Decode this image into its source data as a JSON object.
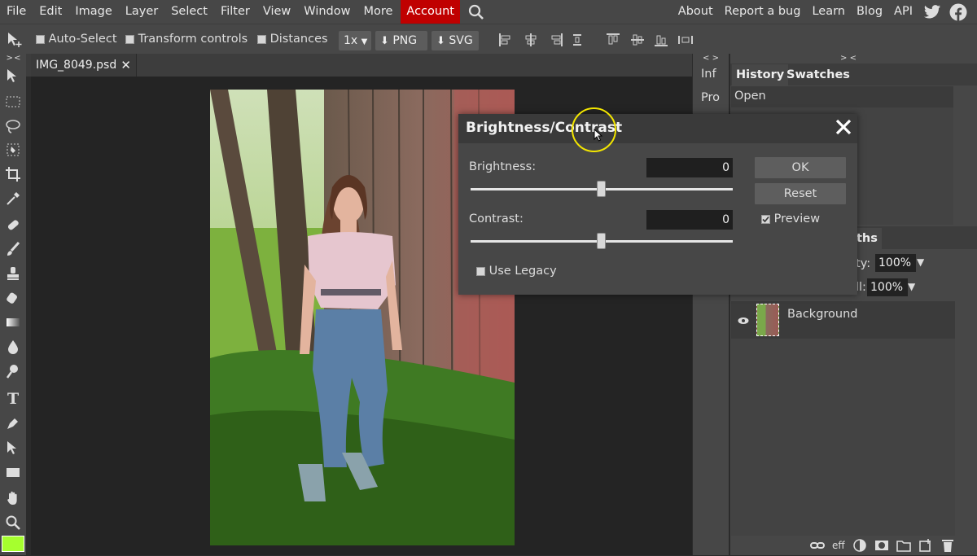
{
  "menu": {
    "left": [
      "File",
      "Edit",
      "Image",
      "Layer",
      "Select",
      "Filter",
      "View",
      "Window",
      "More",
      "Account"
    ],
    "right": [
      "About",
      "Report a bug",
      "Learn",
      "Blog",
      "API"
    ]
  },
  "options": {
    "auto_select": "Auto-Select",
    "transform_controls": "Transform controls",
    "distances": "Distances",
    "zoom": "1x",
    "png": "PNG",
    "svg": "SVG"
  },
  "collapse_glyph_left": "> <",
  "collapse_glyph_mid": "< >",
  "collapse_glyph_right": "> <",
  "document": {
    "tab_name": "IMG_8049.psd"
  },
  "mini_panels": [
    "Inf",
    "Pro"
  ],
  "history": {
    "tabs": [
      "History",
      "Swatches"
    ],
    "items": [
      "Open"
    ]
  },
  "layers": {
    "tab_fragment": "ths",
    "opacity_label": "ity:",
    "opacity_value": "100%",
    "fill_label": "ll:",
    "fill_value": "100%",
    "layer_name": "Background",
    "footer_eff": "eff"
  },
  "dialog": {
    "title": "Brightness/Contrast",
    "brightness_label": "Brightness:",
    "brightness_value": "0",
    "contrast_label": "Contrast:",
    "contrast_value": "0",
    "brightness_level": 0.5,
    "contrast_level": 0.5,
    "use_legacy": "Use Legacy",
    "preview": "Preview",
    "ok": "OK",
    "reset": "Reset"
  },
  "colors": {
    "foreground": "#a6ff2e",
    "account_bg": "#c00000",
    "highlight_ring": "#f3e600"
  }
}
